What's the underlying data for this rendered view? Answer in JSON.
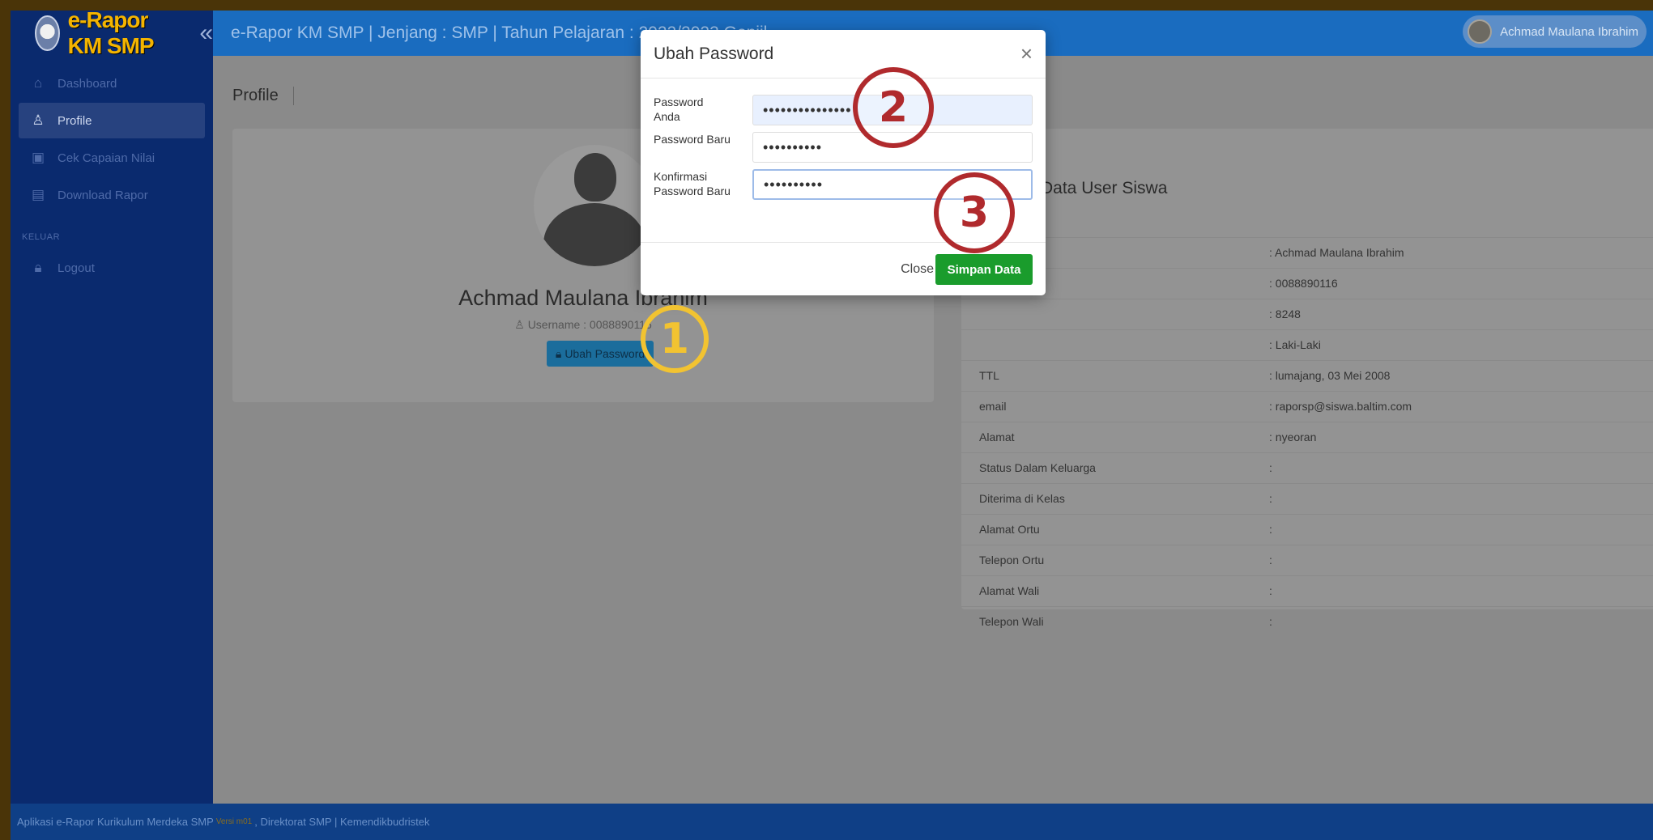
{
  "brand": {
    "name": "e-Rapor KM SMP"
  },
  "sidebar": {
    "items": [
      {
        "label": "Dashboard",
        "icon": "home-icon"
      },
      {
        "label": "Profile",
        "icon": "user-icon"
      },
      {
        "label": "Cek Capaian Nilai",
        "icon": "document-icon"
      },
      {
        "label": "Download Rapor",
        "icon": "printer-icon"
      }
    ],
    "section": "KELUAR",
    "logout": {
      "label": "Logout",
      "icon": "lock-icon"
    }
  },
  "topbar": {
    "title": "e-Rapor KM SMP | Jenjang : SMP | Tahun Pelajaran : 2022/2023 Genjil",
    "user_name": "Achmad Maulana Ibrahim"
  },
  "page": {
    "title": "Profile"
  },
  "profile": {
    "name": "Achmad Maulana Ibrahim",
    "username": "Username : 0088890116",
    "button": "Ubah Password"
  },
  "info": {
    "title": "Data User Siswa",
    "rows": [
      {
        "label": "",
        "value": ": Achmad Maulana Ibrahim"
      },
      {
        "label": "",
        "value": ": 0088890116"
      },
      {
        "label": "",
        "value": ": 8248"
      },
      {
        "label": "",
        "value": ": Laki-Laki"
      },
      {
        "label": "TTL",
        "value": ": lumajang, 03 Mei 2008"
      },
      {
        "label": "email",
        "value": ": raporsp@siswa.baltim.com"
      },
      {
        "label": "Alamat",
        "value": ": nyeoran"
      },
      {
        "label": "Status Dalam Keluarga",
        "value": ":"
      },
      {
        "label": "Diterima di Kelas",
        "value": ":"
      },
      {
        "label": "Alamat Ortu",
        "value": ":"
      },
      {
        "label": "Telepon Ortu",
        "value": ":"
      },
      {
        "label": "Alamat Wali",
        "value": ":"
      },
      {
        "label": "Telepon Wali",
        "value": ":"
      }
    ]
  },
  "modal": {
    "title": "Ubah Password",
    "fields": [
      {
        "label": "Password Anda",
        "value": "•••••••••••••••"
      },
      {
        "label": "Password Baru",
        "value": "••••••••••"
      },
      {
        "label": "Konfirmasi Password Baru",
        "value": "••••••••••"
      }
    ],
    "close_label": "Close",
    "save_label": "Simpan Data"
  },
  "markers": {
    "m1": "1",
    "m2": "2",
    "m3": "3"
  },
  "footer": {
    "text": "Aplikasi e-Rapor Kurikulum Merdeka SMP",
    "version": "Versi m01",
    "suffix": ", Direktorat SMP | Kemendikbudristek"
  },
  "colors": {
    "sidebar": "#0a2a6e",
    "topbar": "#1a6cbf",
    "save": "#1a9c2c",
    "marker_yellow": "#f2c331",
    "marker_red": "#b02a2d"
  }
}
